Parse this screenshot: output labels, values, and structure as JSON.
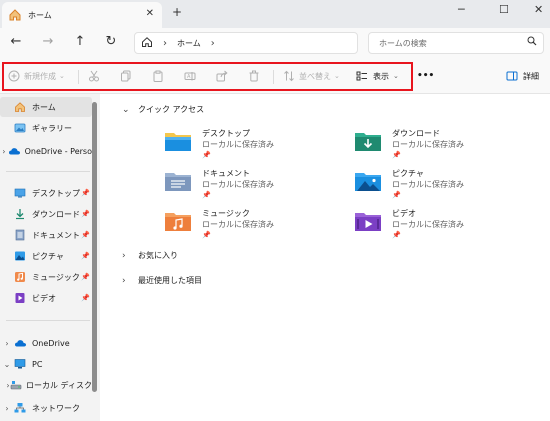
{
  "window": {
    "tab_title": "ホーム",
    "tab_close": "✕",
    "new_tab": "+",
    "minimize": "─",
    "maximize": "☐",
    "close": "✕"
  },
  "navigation": {
    "back": "←",
    "forward": "→",
    "up": "↑",
    "refresh": "↻",
    "breadcrumb": "ホーム",
    "search_placeholder": "ホームの検索"
  },
  "toolbar": {
    "new_label": "新規作成",
    "sort_label": "並べ替え",
    "view_label": "表示",
    "more": "•••",
    "details_label": "詳細"
  },
  "sidebar": {
    "items": [
      {
        "label": "ホーム"
      },
      {
        "label": "ギャラリー"
      },
      {
        "label": "OneDrive - Perso"
      },
      {
        "label": "デスクトップ"
      },
      {
        "label": "ダウンロード"
      },
      {
        "label": "ドキュメント"
      },
      {
        "label": "ピクチャ"
      },
      {
        "label": "ミュージック"
      },
      {
        "label": "ビデオ"
      },
      {
        "label": "OneDrive"
      },
      {
        "label": "PC"
      },
      {
        "label": "ローカル ディスク"
      },
      {
        "label": "ネットワーク"
      }
    ]
  },
  "main": {
    "quick_access": "クイック アクセス",
    "favorites": "お気に入り",
    "recent": "最近使用した項目",
    "folders": [
      {
        "name": "デスクトップ",
        "status": "ローカルに保存済み"
      },
      {
        "name": "ダウンロード",
        "status": "ローカルに保存済み"
      },
      {
        "name": "ドキュメント",
        "status": "ローカルに保存済み"
      },
      {
        "name": "ピクチャ",
        "status": "ローカルに保存済み"
      },
      {
        "name": "ミュージック",
        "status": "ローカルに保存済み"
      },
      {
        "name": "ビデオ",
        "status": "ローカルに保存済み"
      }
    ]
  },
  "colors": {
    "highlight_border": "#e8151e",
    "accent_blue": "#0a6fd1",
    "download_green": "#1f8a70",
    "video_purple": "#7b3fc4"
  }
}
